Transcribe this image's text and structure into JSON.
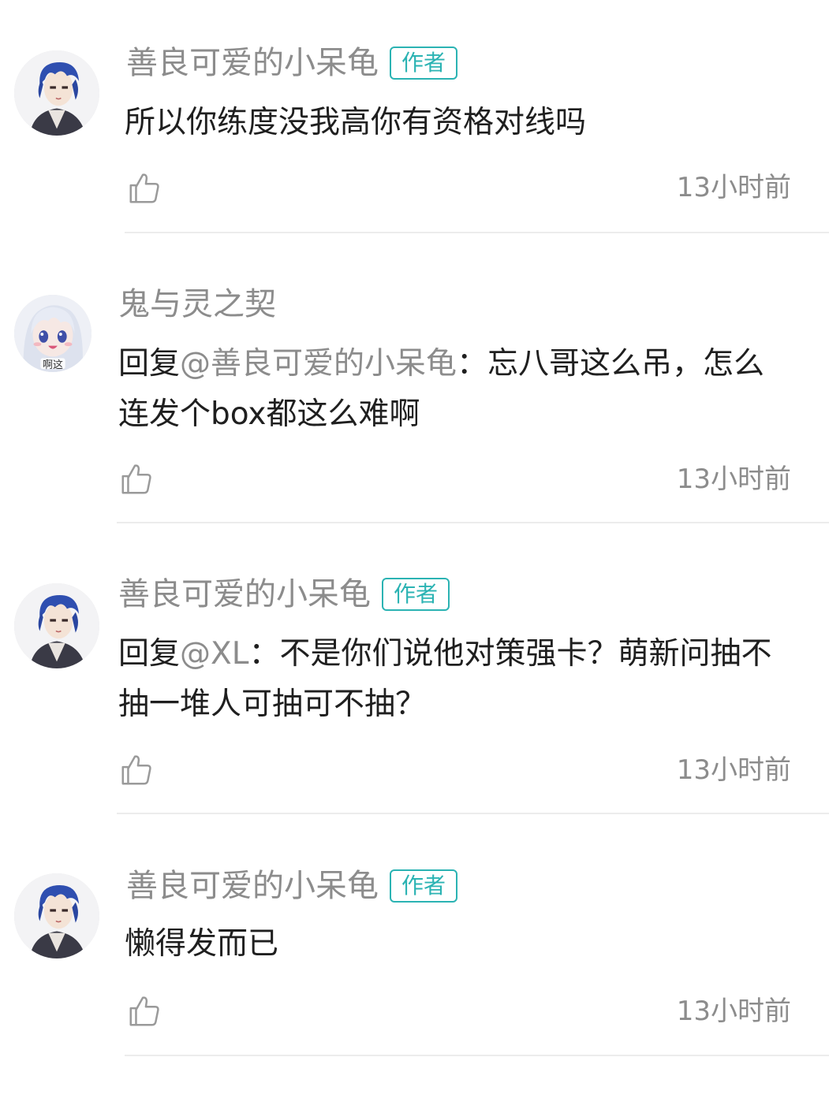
{
  "comments": [
    {
      "username": "善良可爱的小呆龟",
      "badge": "作者",
      "text": "所以你练度没我高你有资格对线吗",
      "time": "13小时前",
      "avatar_icon": "anime-boy-blue-hair-avatar"
    },
    {
      "username": "鬼与灵之契",
      "badge": "",
      "reply_prefix": "回复",
      "mention": "@善良可爱的小呆龟",
      "text": "：忘八哥这么吊，怎么连发个box都这么难啊",
      "time": "13小时前",
      "avatar_icon": "anime-girl-white-hair-avatar",
      "avatar_caption": "啊这"
    },
    {
      "username": "善良可爱的小呆龟",
      "badge": "作者",
      "reply_prefix": "回复",
      "mention": "@XL",
      "text": "：不是你们说他对策强卡？萌新问抽不抽一堆人可抽可不抽？",
      "time": "13小时前",
      "avatar_icon": "anime-boy-blue-hair-avatar"
    },
    {
      "username": "善良可爱的小呆龟",
      "badge": "作者",
      "text": "懒得发而已",
      "time": "13小时前",
      "avatar_icon": "anime-boy-blue-hair-avatar"
    }
  ],
  "colors": {
    "accent": "#2bb3b3",
    "username": "#8c8c8c",
    "text": "#1f1f1f",
    "divider": "#ececec"
  }
}
